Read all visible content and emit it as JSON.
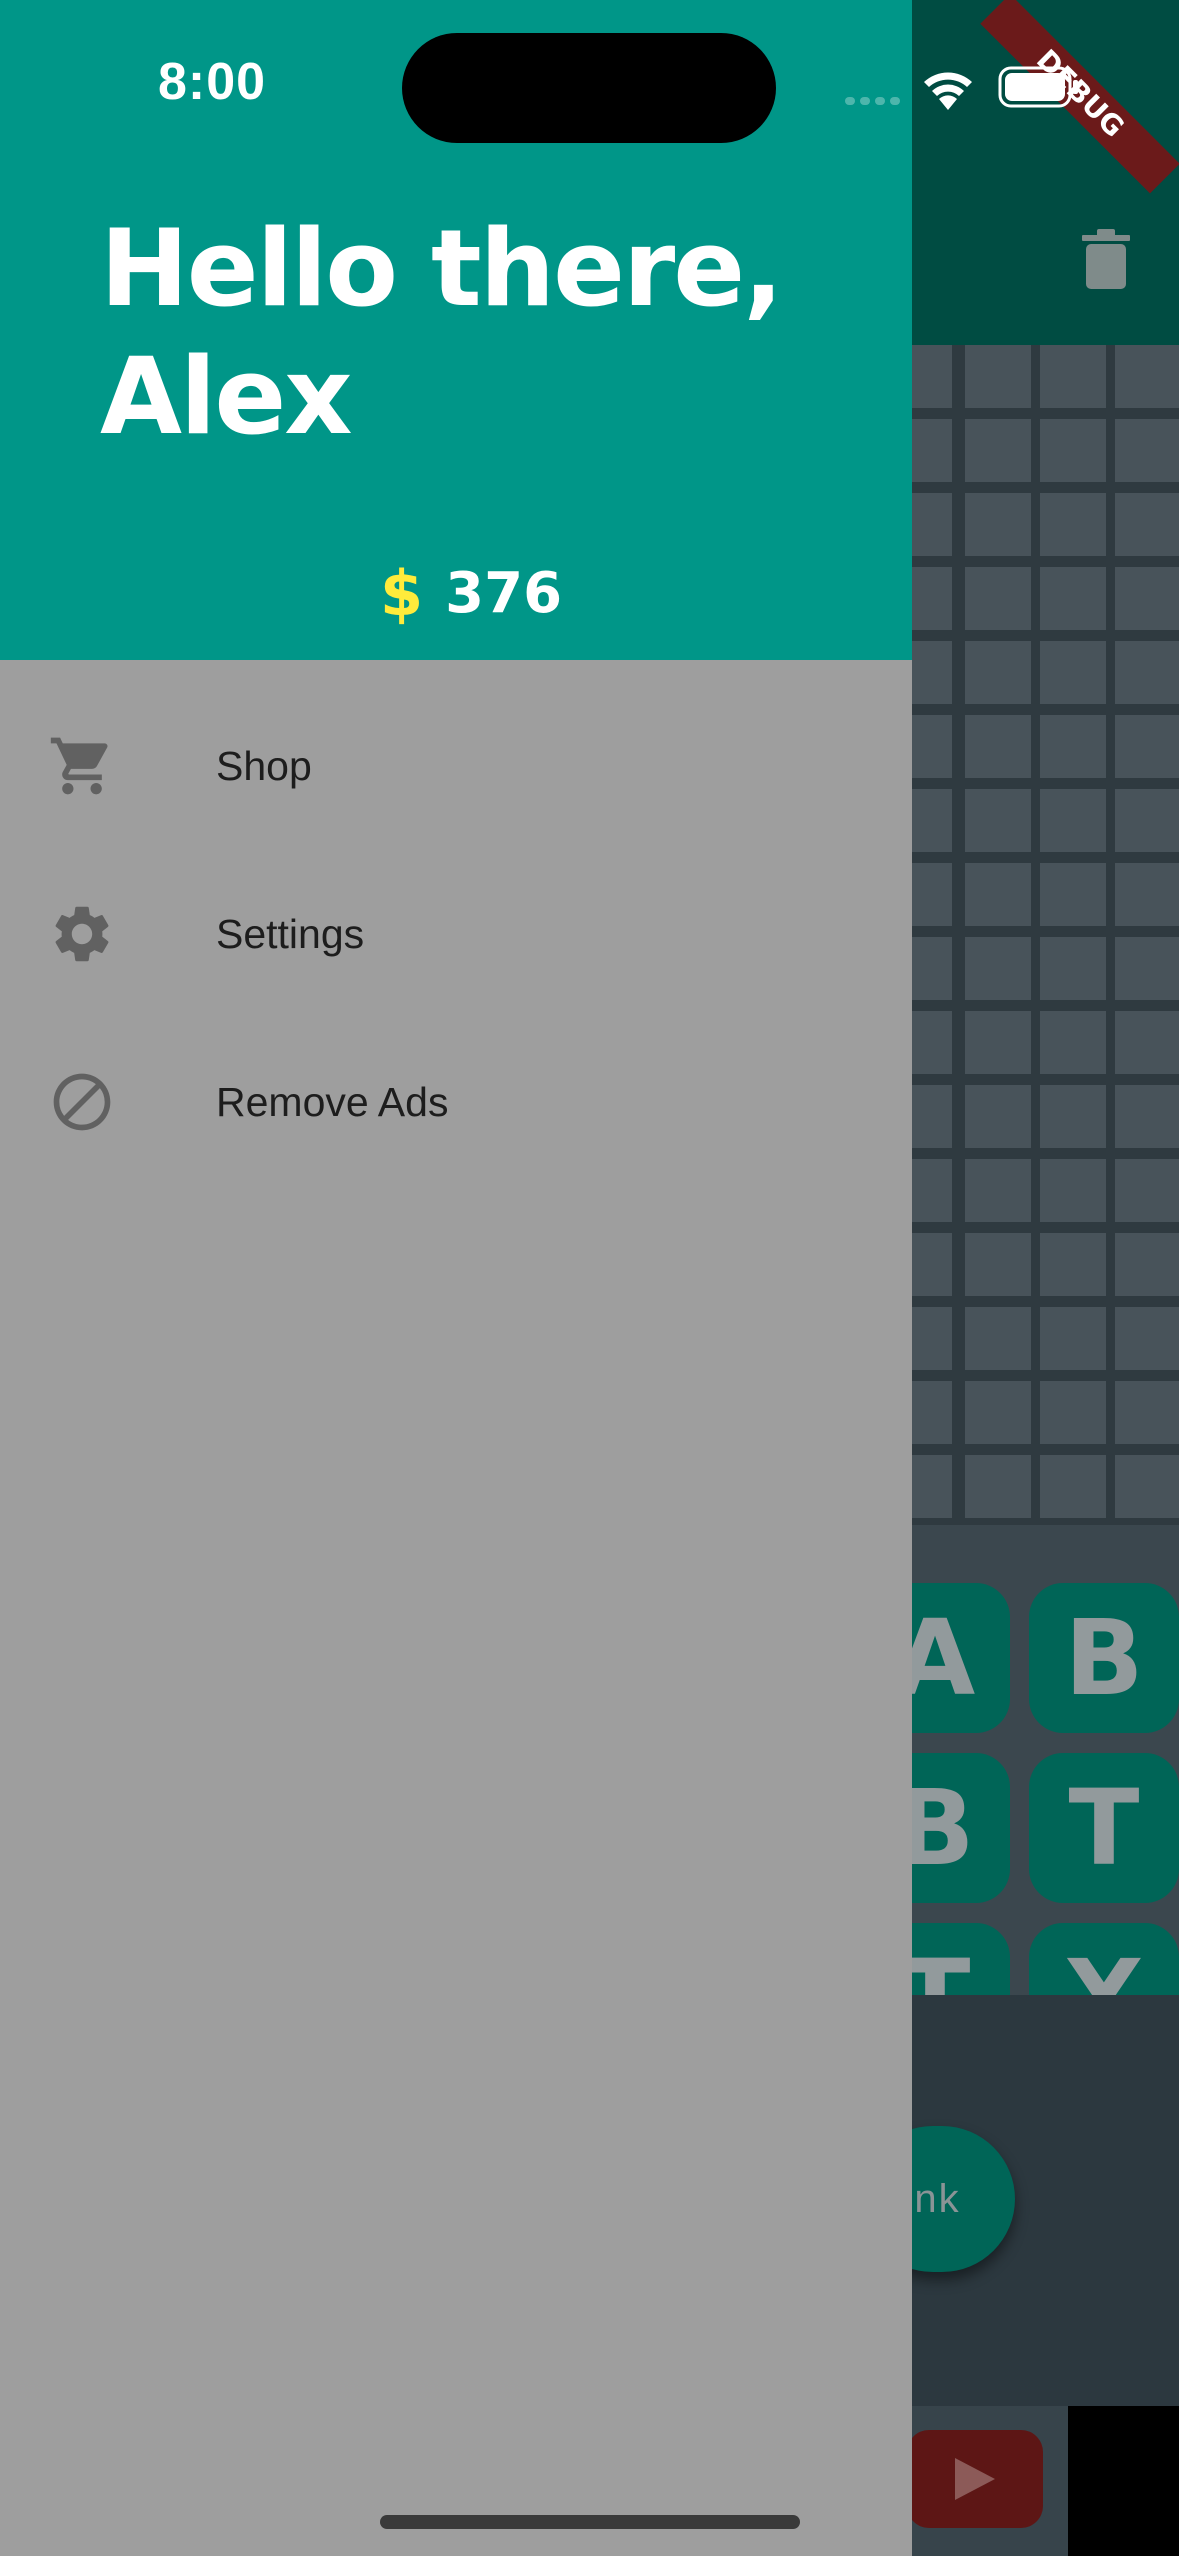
{
  "status_bar": {
    "time": "8:00"
  },
  "debug_banner": {
    "label": "DEBUG"
  },
  "drawer": {
    "greeting": "Hello there, Alex",
    "currency_symbol": "$",
    "coins": "376",
    "menu": [
      {
        "label": "Shop",
        "icon": "cart-icon"
      },
      {
        "label": "Settings",
        "icon": "gear-icon"
      },
      {
        "label": "Remove Ads",
        "icon": "block-icon"
      }
    ]
  },
  "background": {
    "app_bar_action": "trash-icon",
    "letter_tiles": [
      [
        "A",
        "B"
      ],
      [
        "B",
        "T"
      ],
      [
        "T",
        "X"
      ]
    ],
    "action_button_label_visible": "nk",
    "ad_button": "play-icon"
  },
  "colors": {
    "drawer_header": "#009688",
    "drawer_body": "#9e9e9e",
    "coin_symbol": "#ffeb3b",
    "tile": "#006557",
    "debug_ribbon": "#6b1a1a"
  }
}
